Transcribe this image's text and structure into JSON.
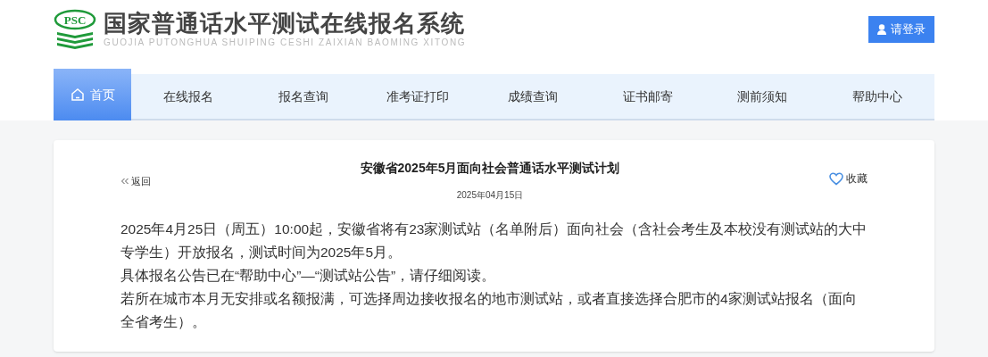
{
  "header": {
    "logo_text": "PSC",
    "title": "国家普通话水平测试在线报名系统",
    "subtitle": "GUOJIA PUTONGHUA SHUIPING CESHI ZAIXIAN BAOMING XITONG",
    "login_button": "请登录"
  },
  "nav": [
    {
      "label": "首页",
      "selected": true
    },
    {
      "label": "在线报名",
      "selected": false
    },
    {
      "label": "报名查询",
      "selected": false
    },
    {
      "label": "准考证打印",
      "selected": false
    },
    {
      "label": "成绩查询",
      "selected": false
    },
    {
      "label": "证书邮寄",
      "selected": false
    },
    {
      "label": "测前须知",
      "selected": false
    },
    {
      "label": "帮助中心",
      "selected": false
    }
  ],
  "article": {
    "back": "返回",
    "title": "安徽省2025年5月面向社会普通话水平测试计划",
    "favorite": "收藏",
    "date": "2025年04月15日",
    "paragraphs": [
      "2025年4月25日（周五）10:00起，安徽省将有23家测试站（名单附后）面向社会（含社会考生及本校没有测试站的大中专学生）开放报名，测试时间为2025年5月。",
      "具体报名公告已在“帮助中心”—“测试站公告”，请仔细阅读。",
      "若所在城市本月无安排或名额报满，可选择周边接收报名的地市测试站，或者直接选择合肥市的4家测试站报名（面向全省考生）。"
    ]
  }
}
